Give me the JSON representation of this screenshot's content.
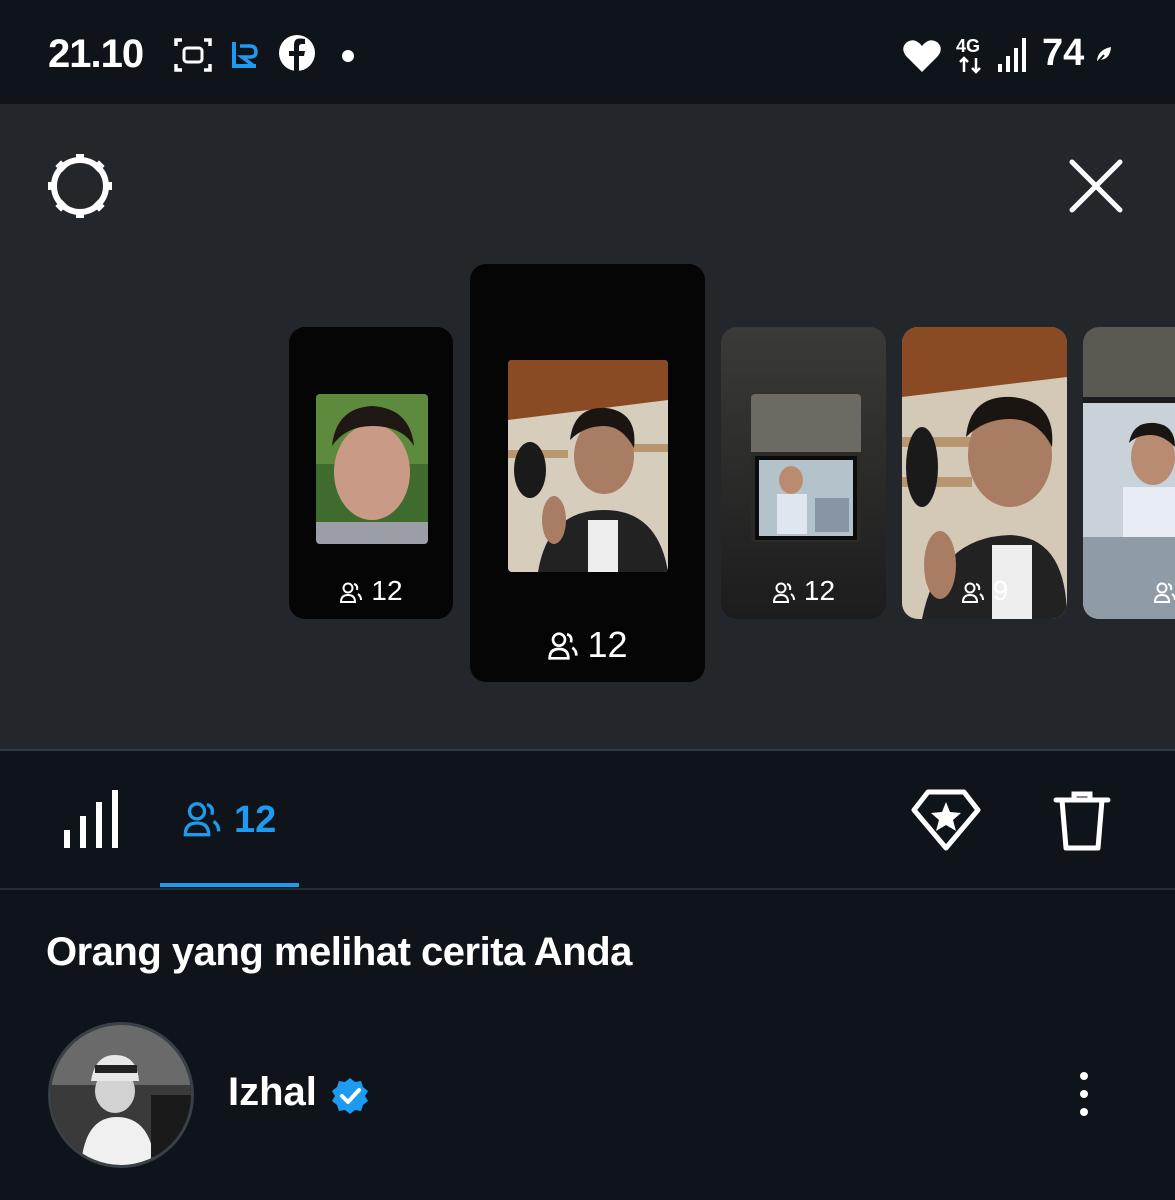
{
  "status_bar": {
    "time": "21.10",
    "left_icons": [
      "screenshot-icon",
      "app-r-icon",
      "facebook-icon",
      "dot-icon"
    ],
    "right_icons": [
      "heart-icon",
      "4g-icon",
      "signal-icon"
    ],
    "network": "4G",
    "battery": "74"
  },
  "panel": {
    "settings_icon": "gear-icon",
    "close_icon": "close-icon"
  },
  "stories": [
    {
      "viewers": "12"
    },
    {
      "viewers": "12",
      "selected": true
    },
    {
      "viewers": "12"
    },
    {
      "viewers": "9"
    },
    {
      "viewers": ""
    }
  ],
  "tabs": {
    "stats_icon": "bar-chart-icon",
    "viewers_icon": "people-icon",
    "viewers_count": "12",
    "highlight_icon": "diamond-star-icon",
    "delete_icon": "trash-icon"
  },
  "viewers_section": {
    "heading": "Orang yang melihat cerita Anda",
    "viewers": [
      {
        "name": "Izhal",
        "verified": true
      }
    ]
  },
  "colors": {
    "accent": "#1d9bf0",
    "background": "#0f141a",
    "panel": "#23262b"
  }
}
